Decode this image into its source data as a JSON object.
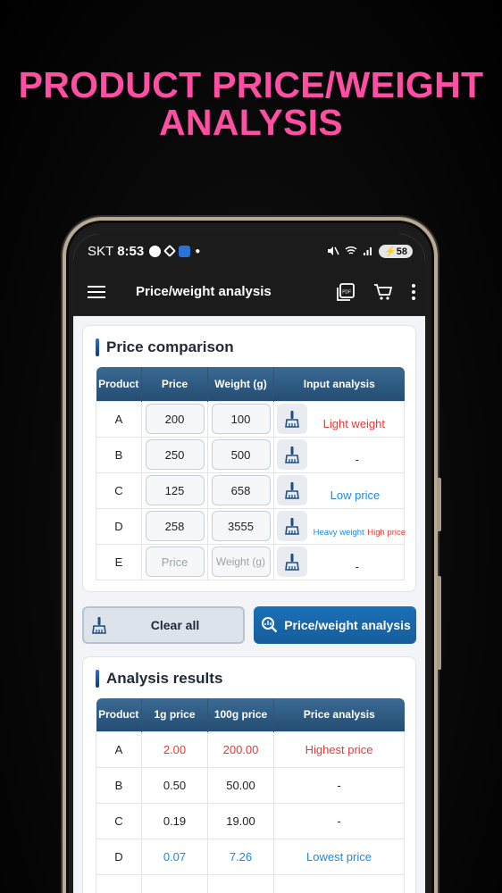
{
  "headline": {
    "line1": "PRODUCT PRICE/WEIGHT",
    "line2": "ANALYSIS"
  },
  "status_bar": {
    "carrier": "SKT",
    "time": "8:53",
    "battery": "58"
  },
  "app_bar": {
    "title": "Price/weight analysis"
  },
  "price_comparison": {
    "title": "Price comparison",
    "headers": [
      "Product",
      "Price",
      "Weight (g)",
      "Input analysis"
    ],
    "rows": [
      {
        "product": "A",
        "price": "200",
        "weight": "100",
        "analysis": "Light weight",
        "analysis2": ""
      },
      {
        "product": "B",
        "price": "250",
        "weight": "500",
        "analysis": "-",
        "analysis2": ""
      },
      {
        "product": "C",
        "price": "125",
        "weight": "658",
        "analysis": "Low price",
        "analysis2": ""
      },
      {
        "product": "D",
        "price": "258",
        "weight": "3555",
        "analysis": "Heavy weight",
        "analysis2": "High price"
      },
      {
        "product": "E",
        "price": "Price",
        "weight": "Weight (g)",
        "analysis": "-",
        "analysis2": ""
      }
    ]
  },
  "buttons": {
    "clear": "Clear all",
    "analyze": "Price/weight analysis"
  },
  "analysis_results": {
    "title": "Analysis results",
    "headers": [
      "Product",
      "1g price",
      "100g price",
      "Price analysis"
    ],
    "rows": [
      {
        "product": "A",
        "g1": "2.00",
        "g100": "200.00",
        "analysis": "Highest price"
      },
      {
        "product": "B",
        "g1": "0.50",
        "g100": "50.00",
        "analysis": "-"
      },
      {
        "product": "C",
        "g1": "0.19",
        "g100": "19.00",
        "analysis": "-"
      },
      {
        "product": "D",
        "g1": "0.07",
        "g100": "7.26",
        "analysis": "Lowest price"
      }
    ]
  },
  "colors": {
    "accent_pink": "#ff4fa3",
    "header_blue": "#2f5d85",
    "primary_button": "#1b6fb6",
    "warn_red": "#e53935",
    "info_blue": "#1e88e5"
  }
}
